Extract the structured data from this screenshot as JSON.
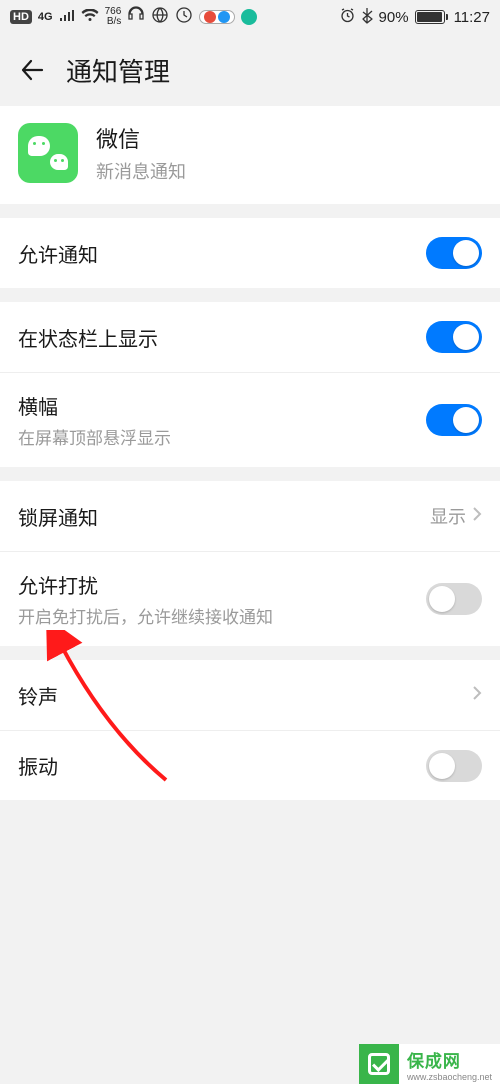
{
  "status": {
    "hd": "HD",
    "net_top": "766",
    "net_bottom": "B/s",
    "battery_pct": "90%",
    "time": "11:27"
  },
  "header": {
    "title": "通知管理"
  },
  "app": {
    "name": "微信",
    "sub": "新消息通知"
  },
  "rows": {
    "allow": {
      "label": "允许通知",
      "on": true
    },
    "statusbar": {
      "label": "在状态栏上显示",
      "on": true
    },
    "banner": {
      "label": "横幅",
      "sub": "在屏幕顶部悬浮显示",
      "on": true
    },
    "lockscreen": {
      "label": "锁屏通知",
      "value": "显示"
    },
    "dnd": {
      "label": "允许打扰",
      "sub": "开启免打扰后，允许继续接收通知",
      "on": false
    },
    "ringtone": {
      "label": "铃声"
    },
    "vibrate": {
      "label": "振动",
      "on": false
    }
  },
  "watermark": {
    "cn": "保成网",
    "en": "www.zsbaocheng.net"
  }
}
